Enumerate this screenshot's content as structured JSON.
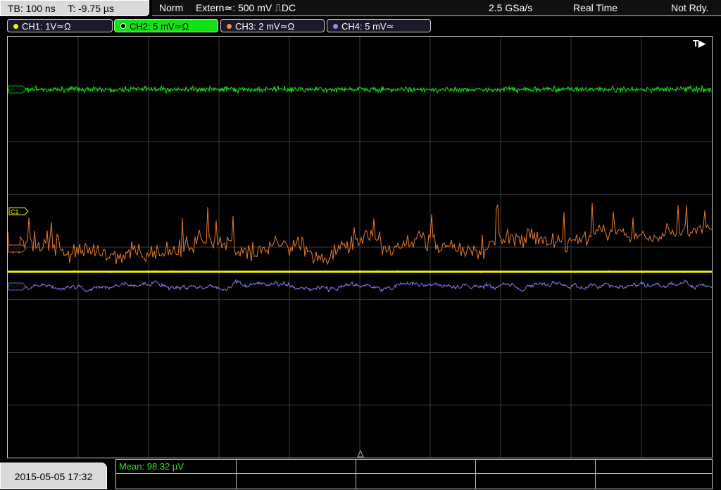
{
  "status_bar": {
    "timebase": "TB: 100 ns",
    "trigger_time": "T: -9.75 µs",
    "mode": "Norm",
    "trigger": "Extern≃: 500 mV ⎍DC",
    "sample_rate": "2.5 GSa/s",
    "acq_mode": "Real Time",
    "state": "Not Rdy."
  },
  "channels": [
    {
      "label": "CH1: 1V≃Ω",
      "color": "#f5f500",
      "active": false
    },
    {
      "label": "CH2: 5 mV≃Ω",
      "color": "#12e212",
      "active": true
    },
    {
      "label": "CH3: 2 mV≃Ω",
      "color": "#ff8a30",
      "active": false
    },
    {
      "label": "CH4: 5 mV≃",
      "color": "#8a8cff",
      "active": false
    }
  ],
  "markers": {
    "ch1": "C1",
    "trigger_pos": "T▶"
  },
  "traces": {
    "ch1": {
      "color": "#f0f000"
    },
    "ch2": {
      "color": "#10e010"
    },
    "ch3": {
      "color": "#e87a28"
    },
    "ch4": {
      "color": "#7e7ff0"
    }
  },
  "bottom": {
    "datetime": "2015-05-05 17:32",
    "measurement": "Mean: 98.32 µV"
  }
}
